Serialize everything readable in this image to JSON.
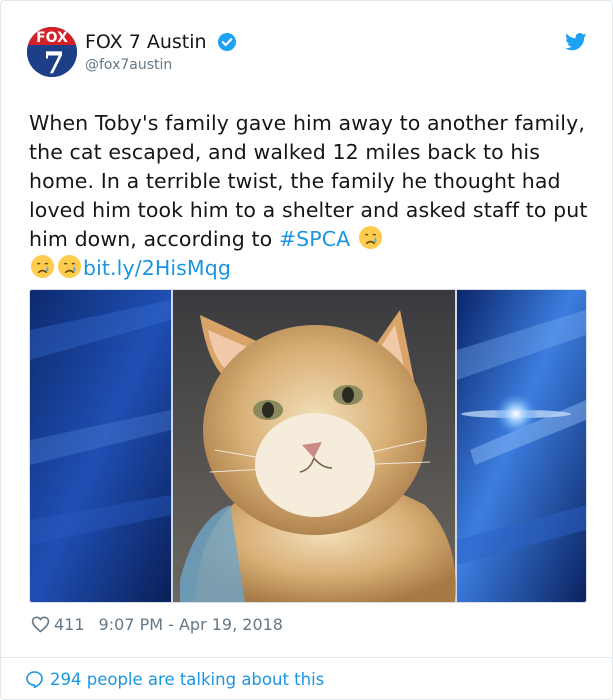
{
  "tweet": {
    "display_name": "FOX 7 Austin",
    "handle": "@fox7austin",
    "verified_icon": "verified-badge-icon",
    "platform_icon": "twitter-bird-icon",
    "avatar": {
      "brand_text": "FOX",
      "channel_number": "7"
    },
    "text_part1": "When Toby's family gave him away to another family, the cat escaped, and walked 12 miles back to his home. In a terrible twist, the family he thought had loved him took him to a shelter and asked staff to put him down, according to ",
    "hashtag": "#SPCA",
    "link": "bit.ly/2HisMqg",
    "emoji": "crying-face",
    "likes": "411",
    "timestamp": "9:07 PM - Apr 19, 2018",
    "conversation": "294 people are talking about this"
  },
  "colors": {
    "link": "#1b95e0",
    "secondary_text": "#657786",
    "primary_text": "#14171a",
    "border": "#e1e8ed"
  }
}
